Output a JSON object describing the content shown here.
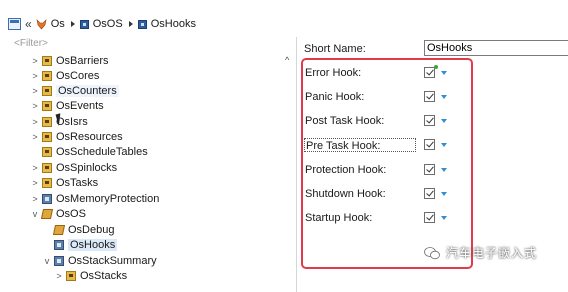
{
  "breadcrumb": {
    "items": [
      {
        "label": "Os",
        "icon": "fox-module-icon"
      },
      {
        "label": "OsOS",
        "icon": "container-icon"
      },
      {
        "label": "OsHooks",
        "icon": "container-icon"
      }
    ]
  },
  "tree": {
    "filter_placeholder": "<Filter>",
    "items": [
      {
        "label": "OsBarriers",
        "icon": "folder-icon",
        "twisty": ">",
        "state": ""
      },
      {
        "label": "OsCores",
        "icon": "folder-icon",
        "twisty": ">",
        "state": ""
      },
      {
        "label": "OsCounters",
        "icon": "folder-icon",
        "twisty": ">",
        "state": "hover"
      },
      {
        "label": "OsEvents",
        "icon": "folder-icon",
        "twisty": ">",
        "state": ""
      },
      {
        "label": "OsIsrs",
        "icon": "folder-icon",
        "twisty": ">",
        "state": ""
      },
      {
        "label": "OsResources",
        "icon": "folder-icon",
        "twisty": ">",
        "state": ""
      },
      {
        "label": "OsScheduleTables",
        "icon": "folder-icon",
        "twisty": "",
        "state": ""
      },
      {
        "label": "OsSpinlocks",
        "icon": "folder-icon",
        "twisty": ">",
        "state": ""
      },
      {
        "label": "OsTasks",
        "icon": "folder-icon",
        "twisty": ">",
        "state": ""
      },
      {
        "label": "OsMemoryProtection",
        "icon": "container-icon",
        "twisty": ">",
        "state": ""
      },
      {
        "label": "OsOS",
        "icon": "container-icon",
        "twisty": "v",
        "state": ""
      },
      {
        "label": "OsDebug",
        "icon": "pen-icon",
        "twisty": "",
        "state": ""
      },
      {
        "label": "OsHooks",
        "icon": "container-icon",
        "twisty": "",
        "state": "selected"
      },
      {
        "label": "OsStackSummary",
        "icon": "container-icon",
        "twisty": "v",
        "state": ""
      },
      {
        "label": "OsStacks",
        "icon": "folder-icon",
        "twisty": ">",
        "state": ""
      }
    ]
  },
  "details": {
    "short_name_label": "Short Name:",
    "short_name_value": "OsHooks",
    "hooks": [
      {
        "label": "Error Hook:",
        "checked": true
      },
      {
        "label": "Panic Hook:",
        "checked": true
      },
      {
        "label": "Post Task Hook:",
        "checked": true
      },
      {
        "label": "Pre Task Hook:",
        "checked": true
      },
      {
        "label": "Protection Hook:",
        "checked": true
      },
      {
        "label": "Shutdown Hook:",
        "checked": true
      },
      {
        "label": "Startup Hook:",
        "checked": true
      }
    ]
  },
  "watermark": {
    "text": "汽车电子嵌入式"
  },
  "colors": {
    "highlight_border": "#e23a4a",
    "selection_bg": "#dbe8f7",
    "dropdown_arrow": "#2f8fd6",
    "folder": "#e7b94a"
  }
}
